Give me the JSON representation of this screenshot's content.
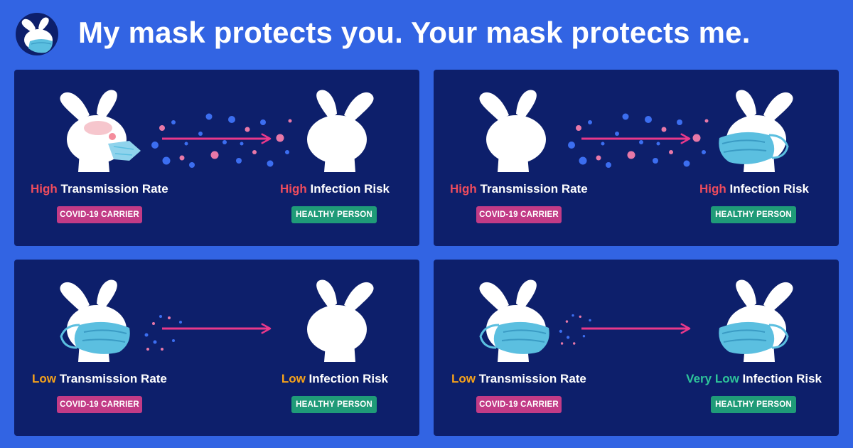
{
  "title": "My mask protects you. Your mask protects me.",
  "colors": {
    "background": "#3264e3",
    "panel": "#0d1f6b",
    "high": "#ef4c5d",
    "low": "#f5a21b",
    "very_low": "#2ec49a",
    "carrier_badge": "#c23b86",
    "healthy_badge": "#1f9b78",
    "mask": "#5bbfe0",
    "arrow": "#e8388a"
  },
  "panels": [
    {
      "transmission_level": "High",
      "transmission_text": " Transmission Rate",
      "infection_level": "High",
      "infection_text": " Infection Risk",
      "carrier_badge": "COVID-19 CARRIER",
      "healthy_badge": "HEALTHY PERSON"
    },
    {
      "transmission_level": "High",
      "transmission_text": " Transmission Rate",
      "infection_level": "High",
      "infection_text": " Infection Risk",
      "carrier_badge": "COVID-19 CARRIER",
      "healthy_badge": "HEALTHY PERSON"
    },
    {
      "transmission_level": "Low",
      "transmission_text": " Transmission Rate",
      "infection_level": "Low",
      "infection_text": " Infection Risk",
      "carrier_badge": "COVID-19 CARRIER",
      "healthy_badge": "HEALTHY PERSON"
    },
    {
      "transmission_level": "Low",
      "transmission_text": " Transmission Rate",
      "infection_level": "Very Low",
      "infection_text": " Infection Risk",
      "carrier_badge": "COVID-19 CARRIER",
      "healthy_badge": "HEALTHY PERSON"
    }
  ]
}
